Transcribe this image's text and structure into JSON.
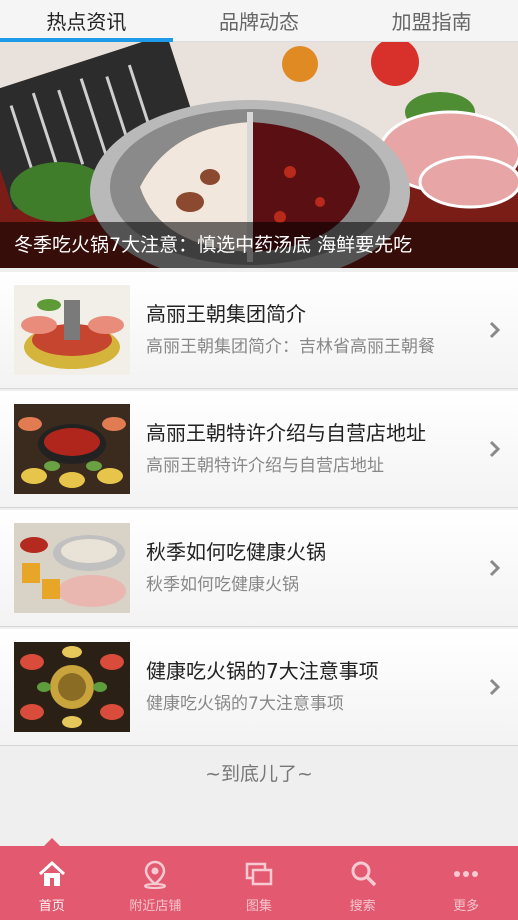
{
  "tabs": [
    {
      "label": "热点资讯"
    },
    {
      "label": "品牌动态"
    },
    {
      "label": "加盟指南"
    }
  ],
  "banner": {
    "caption": "冬季吃火锅7大注意：慎选中药汤底 海鲜要先吃"
  },
  "list": [
    {
      "title": "高丽王朝集团简介",
      "desc": "高丽王朝集团简介：吉林省高丽王朝餐"
    },
    {
      "title": "高丽王朝特许介绍与自营店地址",
      "desc": "高丽王朝特许介绍与自营店地址"
    },
    {
      "title": "秋季如何吃健康火锅",
      "desc": "秋季如何吃健康火锅"
    },
    {
      "title": "健康吃火锅的7大注意事项",
      "desc": "健康吃火锅的7大注意事项"
    }
  ],
  "end_text": "~到底儿了~",
  "bottom_nav": [
    {
      "label": "首页",
      "icon": "home-icon"
    },
    {
      "label": "附近店铺",
      "icon": "location-pin-icon"
    },
    {
      "label": "图集",
      "icon": "gallery-icon"
    },
    {
      "label": "搜索",
      "icon": "search-icon"
    },
    {
      "label": "更多",
      "icon": "more-dots-icon"
    }
  ],
  "colors": {
    "tab_accent": "#1e9be8",
    "nav_bg": "#e35a70"
  }
}
